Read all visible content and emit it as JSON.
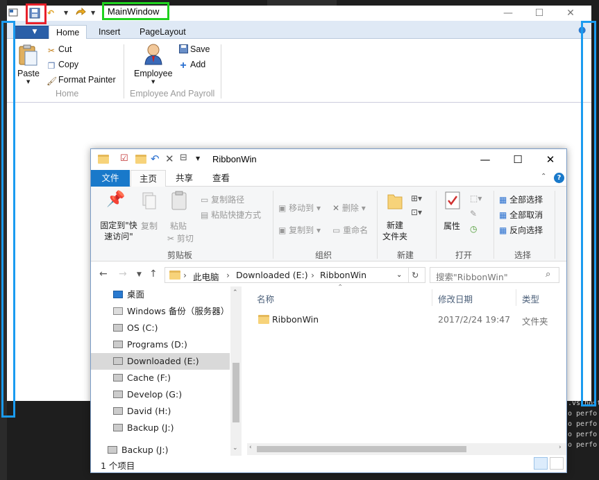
{
  "main_window": {
    "title": "MainWindow",
    "ribbon": {
      "tabs": [
        "Home",
        "Insert",
        "PageLayout"
      ],
      "active_tab": "Home",
      "groups": [
        {
          "label": "Home",
          "big_button": "Paste",
          "small_buttons": [
            "Cut",
            "Copy",
            "Format Painter"
          ]
        },
        {
          "label": "Employee And Payroll",
          "big_button": "Employee",
          "small_buttons": [
            "Save",
            "Add"
          ]
        }
      ]
    }
  },
  "explorer": {
    "title": "RibbonWin",
    "tabs": [
      "文件",
      "主页",
      "共享",
      "查看"
    ],
    "active_tab": "主页",
    "ribbon": {
      "clipboard": {
        "label": "剪贴板",
        "pin": "固定到\"快\n速访问\"",
        "copy": "复制",
        "paste": "粘贴",
        "copy_path": "复制路径",
        "paste_shortcut": "粘贴快捷方式",
        "cut": "剪切"
      },
      "organize": {
        "label": "组织",
        "move_to": "移动到",
        "copy_to": "复制到",
        "delete": "删除",
        "rename": "重命名"
      },
      "new": {
        "label": "新建",
        "new_folder": "新建\n文件夹"
      },
      "open": {
        "label": "打开",
        "properties": "属性"
      },
      "select": {
        "label": "选择",
        "select_all": "全部选择",
        "select_none": "全部取消",
        "invert": "反向选择"
      }
    },
    "breadcrumb": [
      "此电脑",
      "Downloaded (E:)",
      "RibbonWin"
    ],
    "search_placeholder": "搜索\"RibbonWin\"",
    "nav_items": [
      "桌面",
      "Windows 备份（服务器）(",
      "OS (C:)",
      "Programs (D:)",
      "Downloaded (E:)",
      "Cache (F:)",
      "Develop (G:)",
      "David (H:)",
      "Backup (J:)",
      "Backup (J:)"
    ],
    "selected_nav": "Downloaded (E:)",
    "columns": [
      "名称",
      "修改日期",
      "类型"
    ],
    "files": [
      {
        "name": "RibbonWin",
        "modified": "2017/2/24 19:47",
        "type": "文件夹"
      }
    ],
    "status": "1 个项目"
  },
  "console_lines": [
    ".vs.host",
    "o perfo",
    "o perfo",
    "o perfo",
    "o perfo"
  ],
  "colors": {
    "highlight_red": "#e8202a",
    "highlight_green": "#1fd11f",
    "highlight_blue": "#1a9bf0",
    "explorer_accent": "#1979ca"
  }
}
